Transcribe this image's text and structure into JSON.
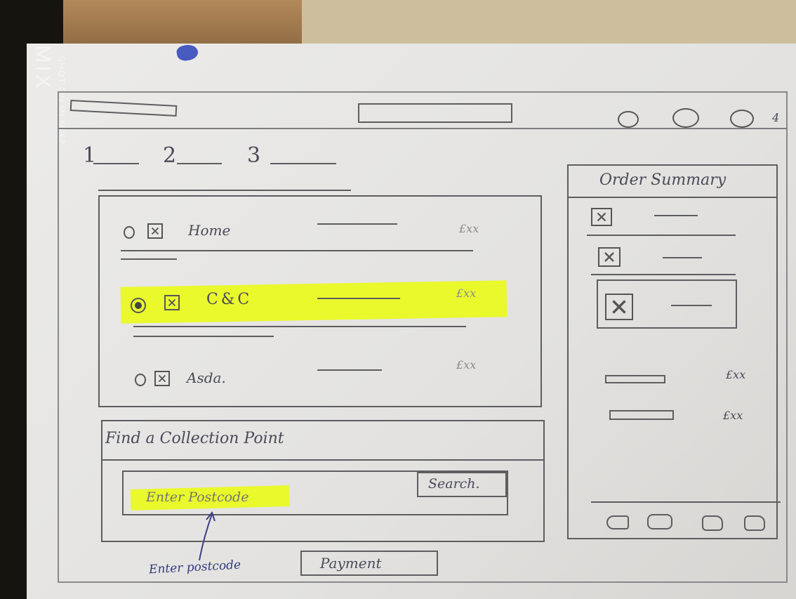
{
  "camera_watermark": {
    "brand": "MIX",
    "caption": "SHOT ON MI MIX2"
  },
  "header": {
    "icon_count_label": "4"
  },
  "steps": {
    "items": [
      "1",
      "2",
      "3"
    ]
  },
  "delivery_options": {
    "items": [
      {
        "label": "Home",
        "price": "£xx",
        "selected": false
      },
      {
        "label": "C&C",
        "price": "£xx",
        "selected": true
      },
      {
        "label": "Asda.",
        "price": "£xx",
        "selected": false
      }
    ]
  },
  "collection_point": {
    "title": "Find a Collection Point",
    "placeholder": "Enter Postcode",
    "search_label": "Search.",
    "annotation": "Enter postcode"
  },
  "payment": {
    "label": "Payment"
  },
  "order_summary": {
    "title": "Order Summary",
    "totals": [
      {
        "price": "£xx"
      },
      {
        "price": "£xx"
      }
    ]
  },
  "colors": {
    "highlighter": "#e9f92c",
    "pencil": "#5e5d60",
    "paper": "#e9e8e6"
  }
}
